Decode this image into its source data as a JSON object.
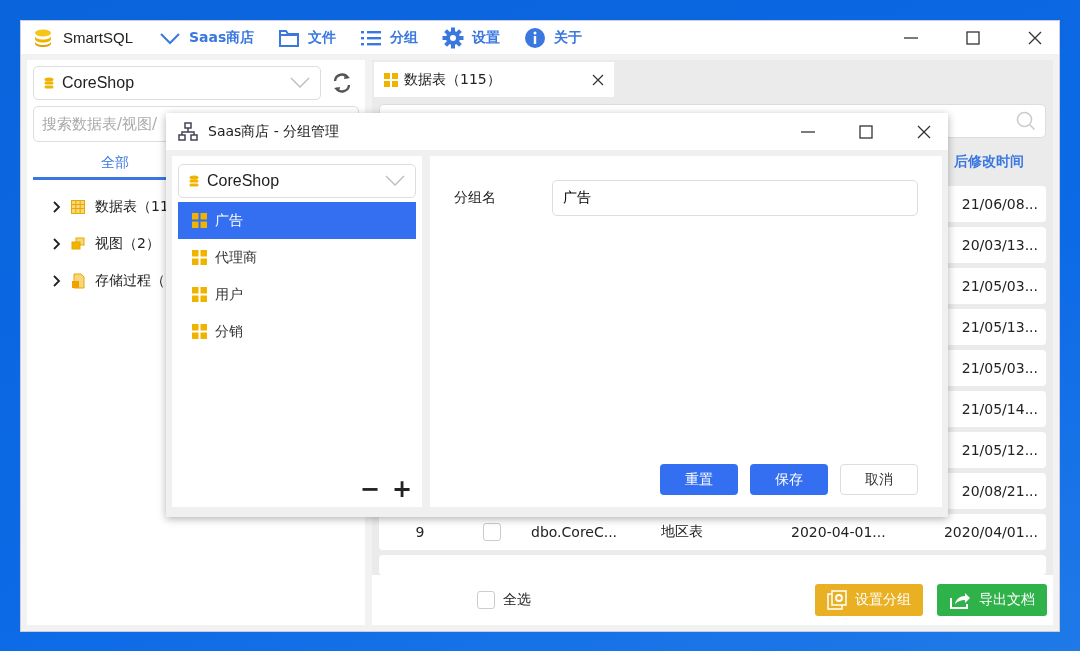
{
  "window": {
    "title": "SmartSQL",
    "menu": [
      {
        "label": "Saas商店"
      },
      {
        "label": "文件"
      },
      {
        "label": "分组"
      },
      {
        "label": "设置"
      },
      {
        "label": "关于"
      }
    ]
  },
  "sidebar": {
    "database": "CoreShop",
    "search": {
      "placeholder": "搜索数据表/视图/"
    },
    "tabs": [
      {
        "label": "全部",
        "selected": true
      }
    ],
    "tree": [
      {
        "label": "数据表（11",
        "expanded": false
      },
      {
        "label": "视图（2）",
        "expanded": false
      },
      {
        "label": "存储过程（",
        "expanded": false
      }
    ]
  },
  "main": {
    "tabs": [
      {
        "label": "数据表（115）",
        "selected": true
      }
    ],
    "table": {
      "columns": [
        "后修改时间"
      ],
      "rows": [
        {
          "cells": [
            "21/06/08..."
          ]
        },
        {
          "cells": [
            "20/03/13..."
          ]
        },
        {
          "cells": [
            "21/05/03..."
          ]
        },
        {
          "cells": [
            "21/05/13..."
          ]
        },
        {
          "cells": [
            "21/05/03..."
          ]
        },
        {
          "cells": [
            "21/05/14..."
          ]
        },
        {
          "cells": [
            "21/05/12..."
          ]
        },
        {
          "cells": [
            "20/08/21..."
          ]
        },
        {
          "number": "9",
          "checked": false,
          "name": "dbo.CoreC...",
          "comment": "地区表",
          "created": "2020-04-01...",
          "cells": [
            "2020/04/01..."
          ]
        }
      ]
    },
    "footer": {
      "select_all": {
        "label": "全选",
        "checked": false
      },
      "buttons": [
        {
          "label": "设置分组",
          "kind": "group"
        },
        {
          "label": "导出文档",
          "kind": "export"
        }
      ]
    }
  },
  "dialog": {
    "title": "Saas商店 - 分组管理",
    "database": "CoreShop",
    "groups": [
      {
        "label": "广告",
        "selected": true
      },
      {
        "label": "代理商",
        "selected": false
      },
      {
        "label": "用户",
        "selected": false
      },
      {
        "label": "分销",
        "selected": false
      }
    ],
    "list_buttons": [
      "−",
      "+"
    ],
    "field": {
      "label": "分组名",
      "value": "广告"
    },
    "buttons": [
      {
        "label": "重置",
        "kind": "primary"
      },
      {
        "label": "保存",
        "kind": "primary"
      },
      {
        "label": "取消",
        "kind": "secondary"
      }
    ]
  }
}
